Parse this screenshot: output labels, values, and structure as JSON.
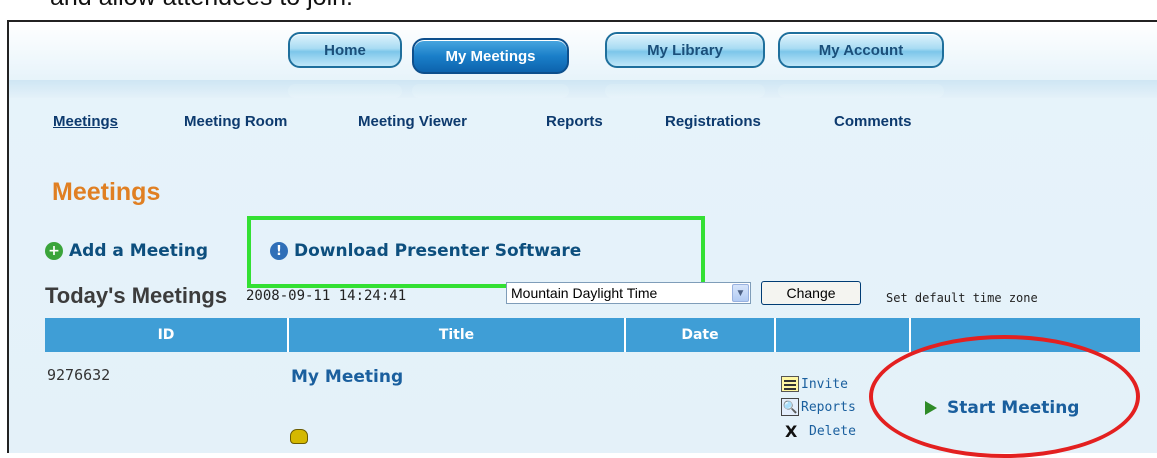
{
  "caption": "and allow attendees to join.",
  "nav": {
    "tabs": [
      {
        "label": "Home",
        "active": false
      },
      {
        "label": "My Meetings",
        "active": true
      },
      {
        "label": "My Library",
        "active": false
      },
      {
        "label": "My Account",
        "active": false
      }
    ]
  },
  "subnav": {
    "items": [
      {
        "label": "Meetings",
        "active": true
      },
      {
        "label": "Meeting Room",
        "active": false
      },
      {
        "label": "Meeting Viewer",
        "active": false
      },
      {
        "label": "Reports",
        "active": false
      },
      {
        "label": "Registrations",
        "active": false
      },
      {
        "label": "Comments",
        "active": false
      }
    ]
  },
  "page": {
    "title": "Meetings",
    "add_meeting": "Add a Meeting",
    "download_presenter": "Download Presenter Software"
  },
  "today": {
    "label": "Today's Meetings",
    "datetime": "2008-09-11 14:24:41",
    "timezone_selected": "Mountain Daylight Time",
    "change_label": "Change",
    "set_default_label": "Set default time zone"
  },
  "table": {
    "headers": [
      "ID",
      "Title",
      "Date",
      "",
      ""
    ],
    "rows": [
      {
        "id": "9276632",
        "title": "My Meeting",
        "date": "",
        "actions": [
          "Invite",
          "Reports",
          "Delete"
        ],
        "start_label": "Start Meeting"
      }
    ]
  },
  "colors": {
    "accent_orange": "#e07f22",
    "header_blue": "#3f9ed6",
    "link_blue": "#1a5f9e",
    "highlight_green": "#33e033",
    "highlight_red": "#e32020"
  },
  "icons": {
    "add": "plus-circle-icon",
    "download": "info-circle-icon",
    "invite": "invite-list-icon",
    "reports": "magnifier-report-icon",
    "delete": "x-icon",
    "start": "play-icon",
    "phone": "phone-icon"
  }
}
